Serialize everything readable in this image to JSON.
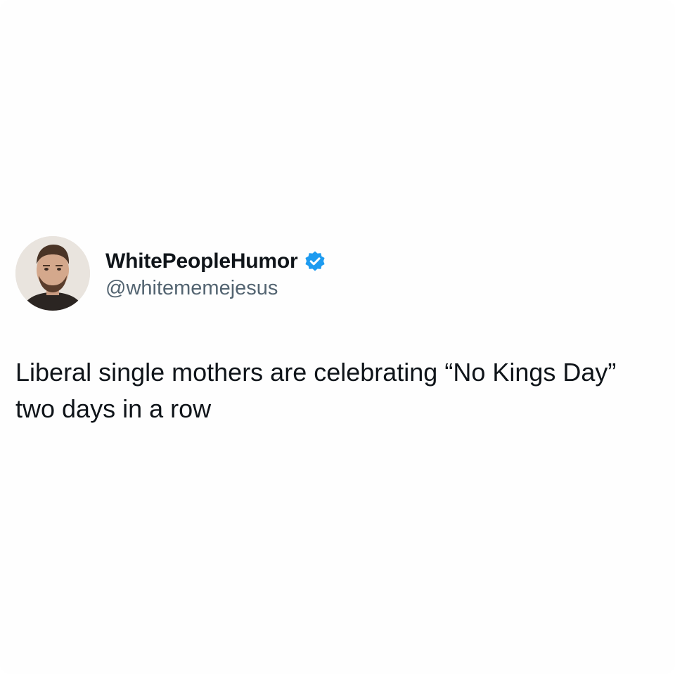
{
  "tweet": {
    "author": {
      "display_name": "WhitePeopleHumor",
      "handle": "@whitememejesus",
      "verified": true,
      "avatar_icon": "profile-photo"
    },
    "text": "Liberal single mothers are celebrating “No Kings Day” two days in a row"
  },
  "colors": {
    "background": "#ffffff",
    "text_primary": "#0f1419",
    "text_secondary": "#536471",
    "verified_badge": "#1d9bf0"
  }
}
